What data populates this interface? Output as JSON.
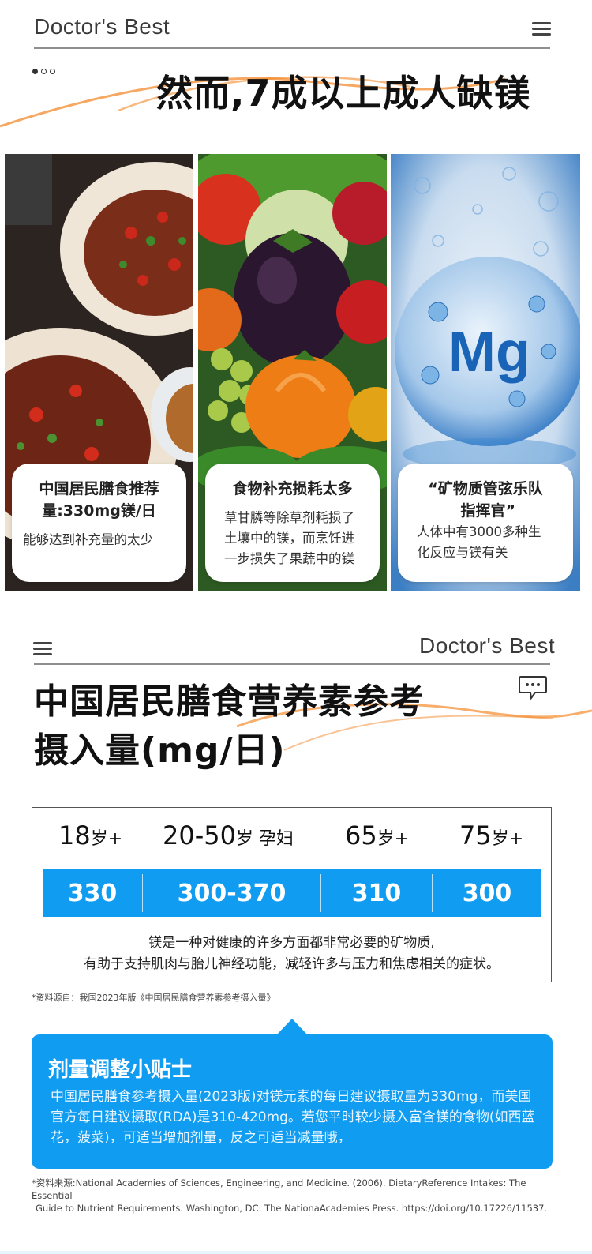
{
  "section1": {
    "brand": "Doctor's Best",
    "title": "然而,7成以上成人缺镁",
    "accent_color": "#f38a2c",
    "panels": [
      {
        "image": "spicy-dish-photo",
        "card_title": "中国居民膳食推荐量:330mg镁/日",
        "card_text": "能够达到补充量的太少"
      },
      {
        "image": "vegetables-photo",
        "card_title": "食物补充损耗太多",
        "card_text": "草甘膦等除草剂耗损了土壤中的镁，而烹饪进一步损失了果蔬中的镁"
      },
      {
        "image": "magnesium-bubble-photo",
        "image_label": "Mg",
        "card_title": "“矿物质管弦乐队指挥官”",
        "card_text": "人体中有3000多种生化反应与镁有关"
      }
    ]
  },
  "section2": {
    "brand": "Doctor's Best",
    "title_line1": "中国居民膳食营养素参考",
    "title_line2": "摄入量(mg/日)",
    "table": {
      "headers": [
        {
          "num": "18",
          "unit": "岁+"
        },
        {
          "num": "20-50",
          "unit": "岁 孕妇"
        },
        {
          "num": "65",
          "unit": "岁+"
        },
        {
          "num": "75",
          "unit": "岁+"
        }
      ],
      "values": [
        "330",
        "300-370",
        "310",
        "300"
      ],
      "note_line1": "镁是一种对健康的许多方面都非常必要的矿物质,",
      "note_line2": "有助于支持肌肉与胎儿神经功能，减轻许多与压力和焦虑相关的症状。"
    },
    "source1": "*资料源自：我国2023年版《中国居民膳食营养素参考摄入量》",
    "tip": {
      "title": "剂量调整小贴士",
      "body": "中国居民膳食参考摄入量(2023版)对镁元素的每日建议摄取量为330mg，而美国官方每日建议摄取(RDA)是310-420mg。若您平时较少摄入富含镁的食物(如西蓝花，菠菜)，可适当增加剂量，反之可适当减量哦，"
    },
    "source2_line1": "*资料来源:National Academies of Sciences, Engineering, and Medicine. (2006). DietaryReference Intakes: The Essential",
    "source2_line2": "Guide to Nutrient Requirements. Washington, DC: The NationaAcademies Press. https://doi.org/10.17226/11537.",
    "primary_color": "#109cf0"
  }
}
